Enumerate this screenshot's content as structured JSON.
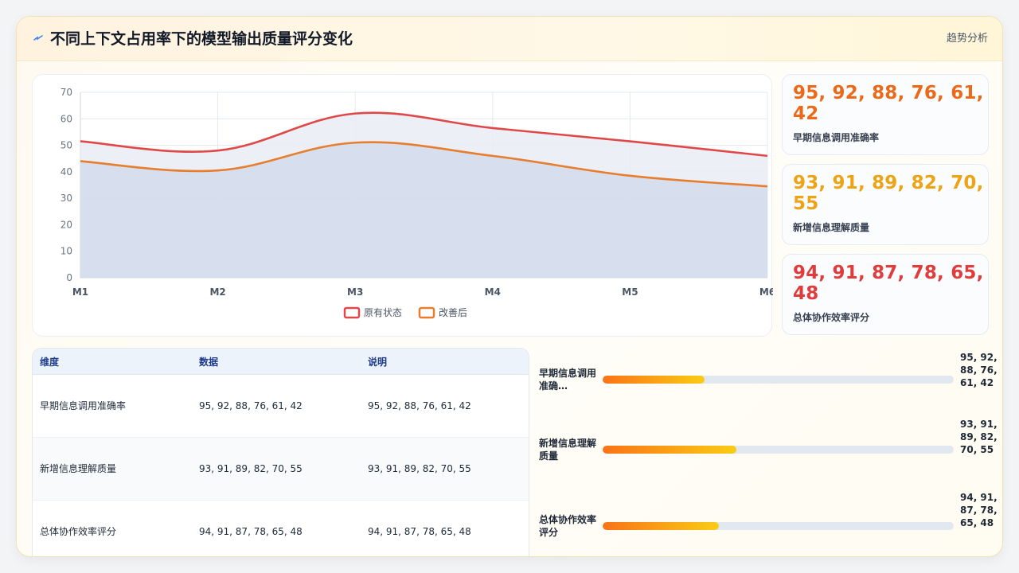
{
  "header": {
    "icon": "flash-icon",
    "title": "不同上下文占用率下的模型输出质量评分变化",
    "action_label": "趋势分析"
  },
  "chart_data": {
    "type": "area",
    "categories": [
      "M1",
      "M2",
      "M3",
      "M4",
      "M5",
      "M6"
    ],
    "ylim": [
      0,
      70
    ],
    "yticks": [
      0,
      10,
      20,
      30,
      40,
      50,
      60,
      70
    ],
    "grid": true,
    "legend_position": "bottom-center",
    "series": [
      {
        "name": "原有状态",
        "color": "#e04848",
        "values": [
          51.5,
          48,
          62,
          56.5,
          51.5,
          46
        ]
      },
      {
        "name": "改善后",
        "color": "#e67e2e",
        "values": [
          44,
          40.5,
          51,
          46,
          38.5,
          34.5
        ]
      }
    ],
    "fill_color": "#c9d3ea"
  },
  "stats": [
    {
      "value": "95, 92, 88, 76, 61, 42",
      "label": "早期信息调用准确率",
      "color": "#ea6a1a"
    },
    {
      "value": "93, 91, 89, 82, 70, 55",
      "label": "新增信息理解质量",
      "color": "#eea315"
    },
    {
      "value": "94, 91, 87, 78, 65, 48",
      "label": "总体协作效率评分",
      "color": "#e03c3c"
    }
  ],
  "table": {
    "headers": [
      "维度",
      "数据",
      "说明"
    ],
    "rows": [
      [
        "早期信息调用准确率",
        "95, 92, 88, 76, 61, 42",
        "95, 92, 88, 76, 61, 42"
      ],
      [
        "新增信息理解质量",
        "93, 91, 89, 82, 70, 55",
        "93, 91, 89, 82, 70, 55"
      ],
      [
        "总体协作效率评分",
        "94, 91, 87, 78, 65, 48",
        "94, 91, 87, 78, 65, 48"
      ]
    ]
  },
  "bars": [
    {
      "label": "早期信息调用准确…",
      "progress": 0.29,
      "value": "95, 92, 88, 76, 61, 42"
    },
    {
      "label": "新增信息理解质量",
      "progress": 0.38,
      "value": "93, 91, 89, 82, 70, 55"
    },
    {
      "label": "总体协作效率评分",
      "progress": 0.33,
      "value": "94, 91, 87, 78, 65, 48"
    }
  ]
}
